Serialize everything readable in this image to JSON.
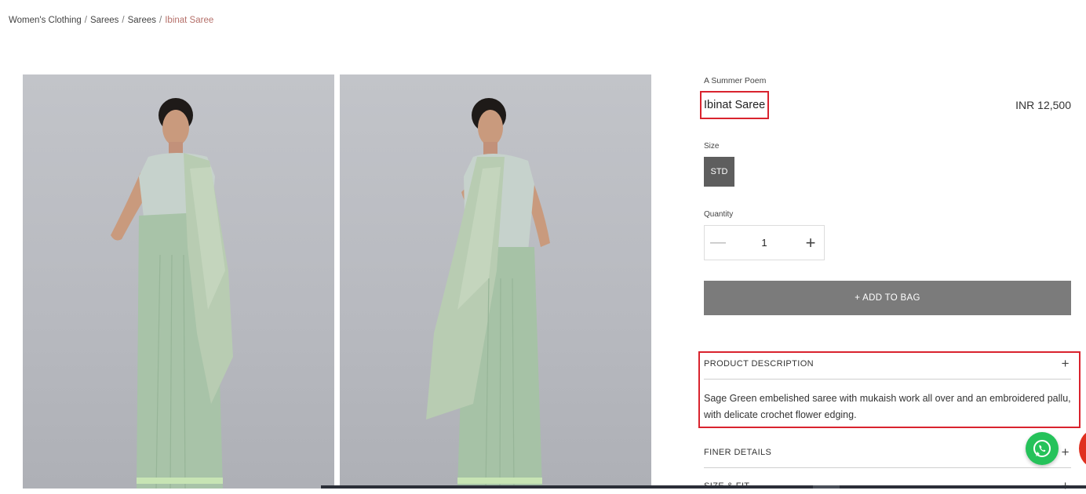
{
  "breadcrumb": {
    "items": [
      "Women's Clothing",
      "Sarees",
      "Sarees"
    ],
    "separator": "/",
    "current": "Ibinat Saree"
  },
  "gallery": {
    "images": [
      {
        "alt": "model-front-view"
      },
      {
        "alt": "model-side-view"
      }
    ]
  },
  "product": {
    "brand": "A Summer Poem",
    "title": "Ibinat Saree",
    "price": "INR 12,500",
    "size_label": "Size",
    "size_option": "STD",
    "quantity_label": "Quantity",
    "quantity_value": "1",
    "add_to_bag": "+ ADD TO BAG"
  },
  "accordion": {
    "description_title": "PRODUCT DESCRIPTION",
    "description_text": "Sage Green embelished saree with mukaish work all over and an embroidered pallu, with delicate crochet flower edging.",
    "finer_details_title": "FINER DETAILS",
    "size_fit_title": "SIZE & FIT",
    "expand_symbol": "+"
  },
  "colors": {
    "accent_red": "#d9232e",
    "breadcrumb_current": "#b5706a",
    "button_gray": "#7b7b7b",
    "size_gray": "#5e5e5e",
    "whatsapp_green": "#25c25a"
  },
  "icons": {
    "minus": "minus-icon",
    "plus": "plus-icon",
    "whatsapp": "whatsapp-icon"
  }
}
